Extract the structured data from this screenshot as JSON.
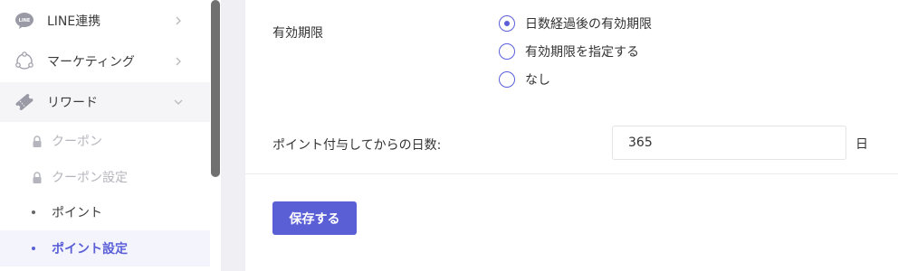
{
  "sidebar": {
    "menu": [
      {
        "label": "LINE連携",
        "icon": "line-icon"
      },
      {
        "label": "マーケティング",
        "icon": "marketing-icon"
      },
      {
        "label": "リワード",
        "icon": "ticket-icon",
        "expanded": true
      }
    ],
    "sub_items": [
      {
        "label": "クーポン",
        "state": "disabled"
      },
      {
        "label": "クーポン設定",
        "state": "disabled"
      },
      {
        "label": "ポイント",
        "state": "normal"
      },
      {
        "label": "ポイント設定",
        "state": "selected"
      }
    ],
    "line_badge": "LINE"
  },
  "form": {
    "expiry_label": "有効期限",
    "expiry_options": [
      {
        "label": "日数経過後の有効期限",
        "checked": true
      },
      {
        "label": "有効期限を指定する",
        "checked": false
      },
      {
        "label": "なし",
        "checked": false
      }
    ],
    "days_label": "ポイント付与してからの日数:",
    "days_value": "365",
    "days_unit": "日",
    "save_label": "保存する"
  },
  "colors": {
    "accent": "#5a5fd8",
    "disabled_text": "#b5b5bd",
    "scrollbar": "#707070"
  }
}
